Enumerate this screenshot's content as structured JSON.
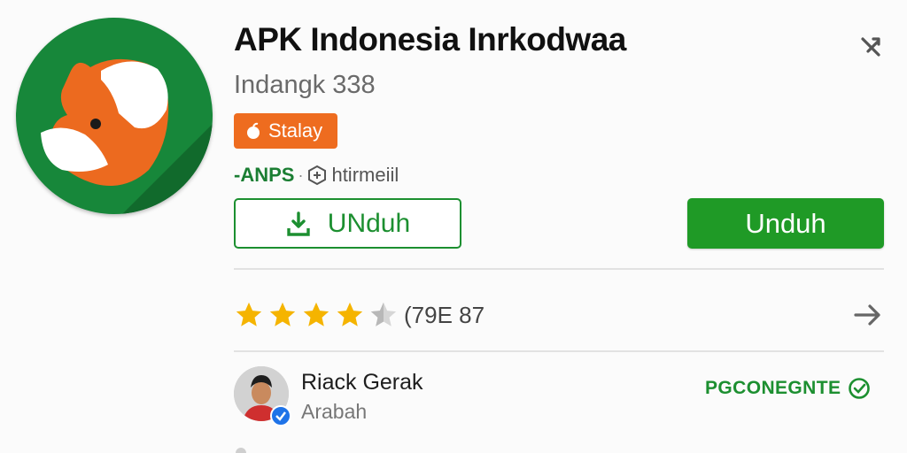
{
  "app": {
    "title": "APK Indonesia Inrkodwaa",
    "developer": "Indangk 338",
    "badge_label": "Stalay",
    "rating_label": "-ANPS",
    "rating_separator": "·",
    "info_label": "htirmeiil",
    "icon_name": "fox-app-icon"
  },
  "actions": {
    "outline_button_label": "UNduh",
    "filled_button_label": "Unduh"
  },
  "rating": {
    "stars": 4.5,
    "max_stars": 5,
    "count_label": "(79E 87"
  },
  "review": {
    "reviewer_name": "Riack Gerak",
    "reviewer_sub": "Arabah",
    "status_label": "PGCONEGNTE"
  },
  "colors": {
    "brand_green": "#1f9a26",
    "badge_orange": "#ee6c1f",
    "star_gold": "#f5b400",
    "icon_background": "#17873a"
  }
}
